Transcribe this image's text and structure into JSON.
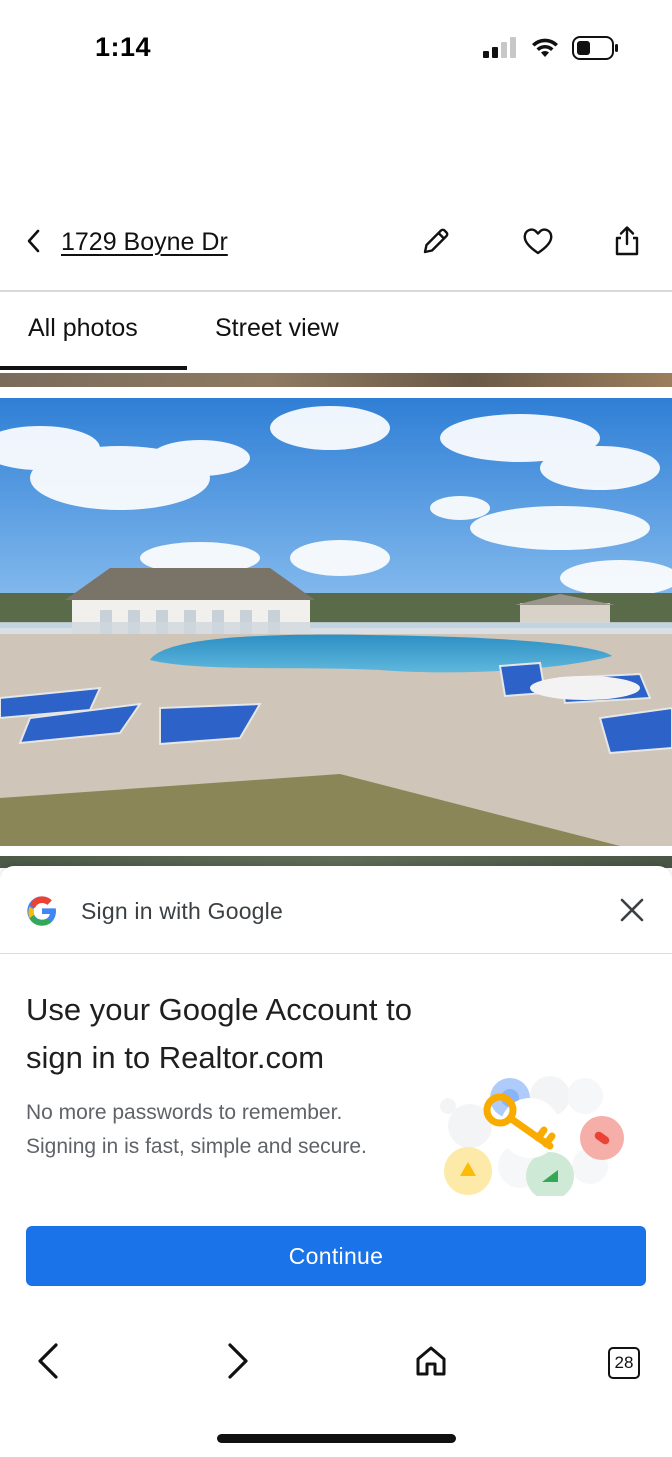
{
  "status_bar": {
    "time": "1:14"
  },
  "header": {
    "address": "1729 Boyne Dr",
    "icons": [
      "back-chevron-icon",
      "pencil-icon",
      "heart-icon",
      "share-icon"
    ]
  },
  "tabs": [
    {
      "label": "All photos",
      "active": true
    },
    {
      "label": "Street view",
      "active": false
    }
  ],
  "photo": {
    "subject": "community pool with lounge chairs and clubhouse"
  },
  "google_sheet": {
    "title": "Sign in with Google",
    "heading": "Use your Google Account to sign in to Realtor.com",
    "body": "No more passwords to remember. Signing in is fast, simple and secure.",
    "button_label": "Continue",
    "accent_color": "#1a73e8"
  },
  "bottom_nav": {
    "tab_count": "28",
    "icons": [
      "back-arrow-icon",
      "forward-arrow-icon",
      "home-icon",
      "tabs-icon"
    ]
  }
}
